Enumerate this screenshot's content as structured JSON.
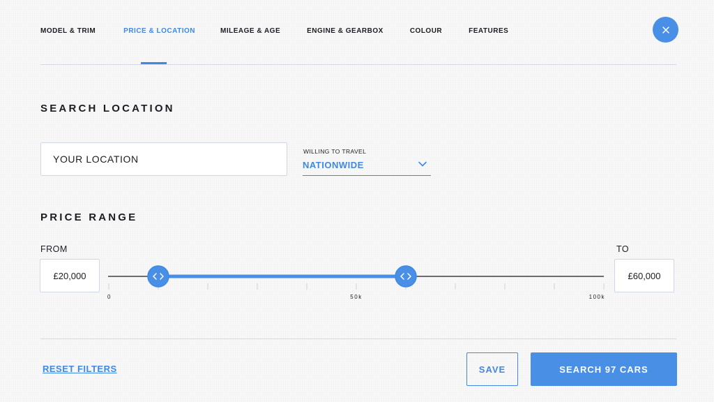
{
  "tabs": [
    {
      "label": "MODEL & TRIM",
      "active": false
    },
    {
      "label": "PRICE & LOCATION",
      "active": true
    },
    {
      "label": "MILEAGE & AGE",
      "active": false
    },
    {
      "label": "ENGINE & GEARBOX",
      "active": false
    },
    {
      "label": "COLOUR",
      "active": false
    },
    {
      "label": "FEATURES",
      "active": false
    }
  ],
  "close_icon": "close-icon",
  "search_location": {
    "title": "SEARCH LOCATION",
    "location_placeholder": "YOUR LOCATION",
    "travel_label": "WILLING TO TRAVEL",
    "travel_value": "NATIONWIDE",
    "travel_icon": "chevron-down-icon"
  },
  "price_range": {
    "title": "PRICE RANGE",
    "from_label": "FROM",
    "to_label": "TO",
    "from_value": "£20,000",
    "to_value": "£60,000",
    "slider": {
      "min": 0,
      "max": 100000,
      "low": 10000,
      "high": 60000,
      "tick_labels": [
        {
          "value": 0,
          "label": "0"
        },
        {
          "value": 50000,
          "label": "50k"
        },
        {
          "value": 100000,
          "label": "100k"
        }
      ],
      "minor_ticks": [
        10000,
        20000,
        30000,
        40000,
        60000,
        70000,
        80000,
        90000
      ],
      "handle_icon": "chevron-left-right-icon"
    }
  },
  "footer": {
    "reset_label": "RESET FILTERS",
    "save_label": "SAVE",
    "search_label": "SEARCH 97 CARS"
  },
  "colors": {
    "accent": "#3f88e5",
    "accent_button": "#4a8fe6",
    "text": "#1c1c22",
    "border": "#d3d6e6"
  }
}
